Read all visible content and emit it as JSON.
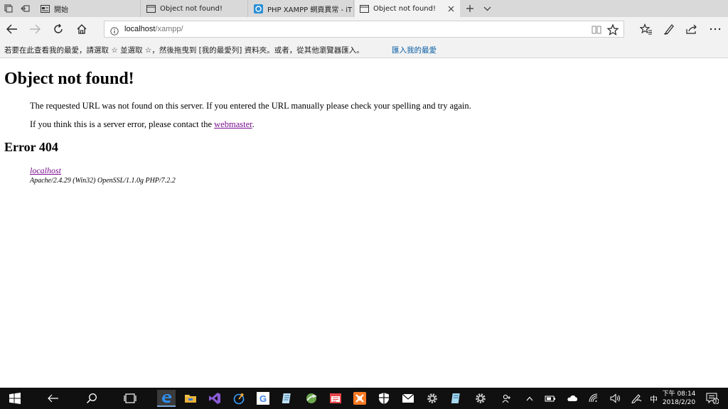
{
  "colors": {
    "tab_strip": "#d9d9d9",
    "toolbar": "#f2f2f2",
    "link_visited": "#7a0e8f",
    "favorites_link": "#0b5fa5",
    "taskbar": "#101010"
  },
  "tabs": [
    {
      "title": "開始",
      "icon": "start-page-icon",
      "active": false
    },
    {
      "title": "Object not found!",
      "icon": "page-icon",
      "active": false
    },
    {
      "title": "PHP XAMPP 網頁異常 - iT 邦",
      "icon": "ithome-icon",
      "active": false
    },
    {
      "title": "Object not found!",
      "icon": "page-icon",
      "active": true
    }
  ],
  "address": {
    "host": "localhost",
    "path": "/xampp/"
  },
  "favorites_bar": {
    "message": "若要在此查看我的最愛，請選取 ☆ 並選取 ☆，然後拖曳到 [我的最愛列] 資料夾。或者，從其他瀏覽器匯入。",
    "import_link": "匯入我的最愛"
  },
  "page": {
    "title": "Object not found!",
    "paragraph1": "The requested URL was not found on this server. If you entered the URL manually please check your spelling and try again.",
    "paragraph2_prefix": "If you think this is a server error, please contact the ",
    "webmaster_link": "webmaster",
    "paragraph2_suffix": ".",
    "error_heading": "Error 404",
    "address_link": "localhost",
    "server_signature": "Apache/2.4.29 (Win32) OpenSSL/1.1.0g PHP/7.2.2"
  },
  "taskbar": {
    "apps": [
      "start-icon",
      "back-icon",
      "search-icon",
      "task-view-icon",
      "edge-icon",
      "file-explorer-icon",
      "visual-studio-icon",
      "app-icon",
      "chrome-icon",
      "notepad-icon",
      "app-icon",
      "calendar-app-icon",
      "xampp-icon",
      "shield-app-icon",
      "mail-icon",
      "settings-icon",
      "editor-icon",
      "settings-icon"
    ],
    "ime": "中",
    "clock_time": "下午 08:14",
    "clock_date": "2018/2/20",
    "notification_count": "3"
  }
}
